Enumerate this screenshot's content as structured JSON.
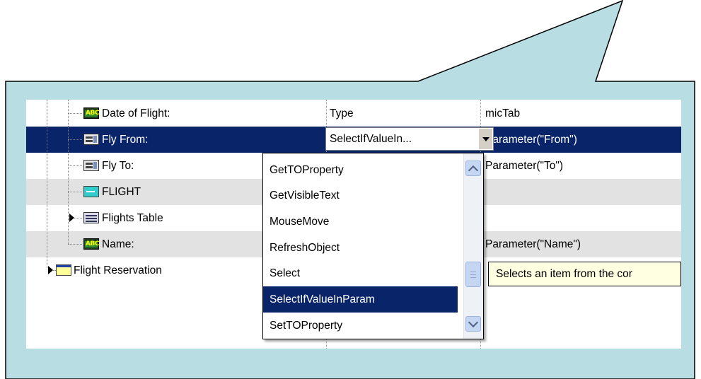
{
  "tree": {
    "rows": [
      {
        "name": "Date of Flight:",
        "operation": "Type",
        "value": "micTab",
        "icon": "abc-edit-icon"
      },
      {
        "name": "Fly From:",
        "operation": "SelectIfValueIn...",
        "value": "Parameter(\"From\")",
        "icon": "combo-box-icon"
      },
      {
        "name": "Fly To:",
        "operation": "",
        "value": "Parameter(\"To\")",
        "icon": "combo-box-icon"
      },
      {
        "name": "FLIGHT",
        "operation": "",
        "value": "",
        "icon": "edit-field-icon"
      },
      {
        "name": "Flights Table",
        "operation": "",
        "value": "",
        "icon": "table-icon"
      },
      {
        "name": "Name:",
        "operation": "",
        "value": "Parameter(\"Name\")",
        "icon": "abc-edit-icon"
      },
      {
        "name": "Flight Reservation",
        "operation": "",
        "value": "",
        "icon": "window-icon"
      }
    ]
  },
  "dropdown": {
    "options": [
      "GetTOProperty",
      "GetVisibleText",
      "MouseMove",
      "RefreshObject",
      "Select",
      "SelectIfValueInParam",
      "SetTOProperty"
    ],
    "selected": "SelectIfValueInParam"
  },
  "tooltip": {
    "text": "Selects an item from the cor"
  },
  "icons": {
    "abc_text": "ABC"
  },
  "colors": {
    "callout_fill": "#b8dde3",
    "selection": "#0a246a",
    "alt_row": "#e2e2e2",
    "tooltip_bg": "#ffffe1"
  }
}
